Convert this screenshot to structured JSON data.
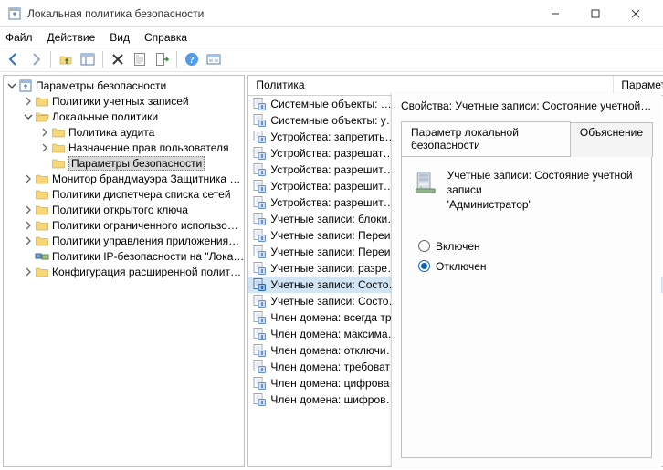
{
  "window": {
    "title": "Локальная политика безопасности"
  },
  "menu": {
    "file": "Файл",
    "action": "Действие",
    "view": "Вид",
    "help": "Справка"
  },
  "tree": {
    "root": "Параметры безопасности",
    "items": [
      {
        "label": "Политики учетных записей",
        "level": 1,
        "exp": "closed",
        "icon": "folder"
      },
      {
        "label": "Локальные политики",
        "level": 1,
        "exp": "open",
        "icon": "folder-open"
      },
      {
        "label": "Политика аудита",
        "level": 2,
        "exp": "closed",
        "icon": "folder"
      },
      {
        "label": "Назначение прав пользователя",
        "level": 2,
        "exp": "closed",
        "icon": "folder"
      },
      {
        "label": "Параметры безопасности",
        "level": 2,
        "exp": "none",
        "icon": "folder",
        "selected": true
      },
      {
        "label": "Монитор брандмауэра Защитника …",
        "level": 1,
        "exp": "closed",
        "icon": "folder"
      },
      {
        "label": "Политики диспетчера списка сетей",
        "level": 1,
        "exp": "none",
        "icon": "folder"
      },
      {
        "label": "Политики открытого ключа",
        "level": 1,
        "exp": "closed",
        "icon": "folder"
      },
      {
        "label": "Политики ограниченного использо…",
        "level": 1,
        "exp": "closed",
        "icon": "folder"
      },
      {
        "label": "Политики управления приложения…",
        "level": 1,
        "exp": "closed",
        "icon": "folder"
      },
      {
        "label": "Политики IP-безопасности на \"Лока…",
        "level": 1,
        "exp": "none",
        "icon": "ipsec"
      },
      {
        "label": "Конфигурация расширенной полит…",
        "level": 1,
        "exp": "closed",
        "icon": "folder"
      }
    ]
  },
  "list": {
    "header_policy": "Политика",
    "header_setting": "Параметр бе…",
    "rows": [
      {
        "label": "Системные объекты: …"
      },
      {
        "label": "Системные объекты: у…"
      },
      {
        "label": "Устройства: запретить…"
      },
      {
        "label": "Устройства: разрешат…"
      },
      {
        "label": "Устройства: разрешит…"
      },
      {
        "label": "Устройства: разрешит…"
      },
      {
        "label": "Устройства: разрешит…"
      },
      {
        "label": "Учетные записи: блоки…"
      },
      {
        "label": "Учетные записи: Переи…"
      },
      {
        "label": "Учетные записи: Переи…"
      },
      {
        "label": "Учетные записи: разре…"
      },
      {
        "label": "Учетные записи: Состо…",
        "selected": true
      },
      {
        "label": "Учетные записи: Состо…"
      },
      {
        "label": "Член домена: всегда тр…"
      },
      {
        "label": "Член домена: максима…"
      },
      {
        "label": "Член домена: отключи…"
      },
      {
        "label": "Член домена: требоват…"
      },
      {
        "label": "Член домена: цифрова…"
      },
      {
        "label": "Член домена: шифров…"
      }
    ]
  },
  "dialog": {
    "title": "Свойства: Учетные записи: Состояние учетной записи '…",
    "tab_local": "Параметр локальной безопасности",
    "tab_explain": "Объяснение",
    "policy_name_line1": "Учетные записи: Состояние учетной записи",
    "policy_name_line2": "'Администратор'",
    "radio_enabled": "Включен",
    "radio_disabled": "Отключен"
  }
}
